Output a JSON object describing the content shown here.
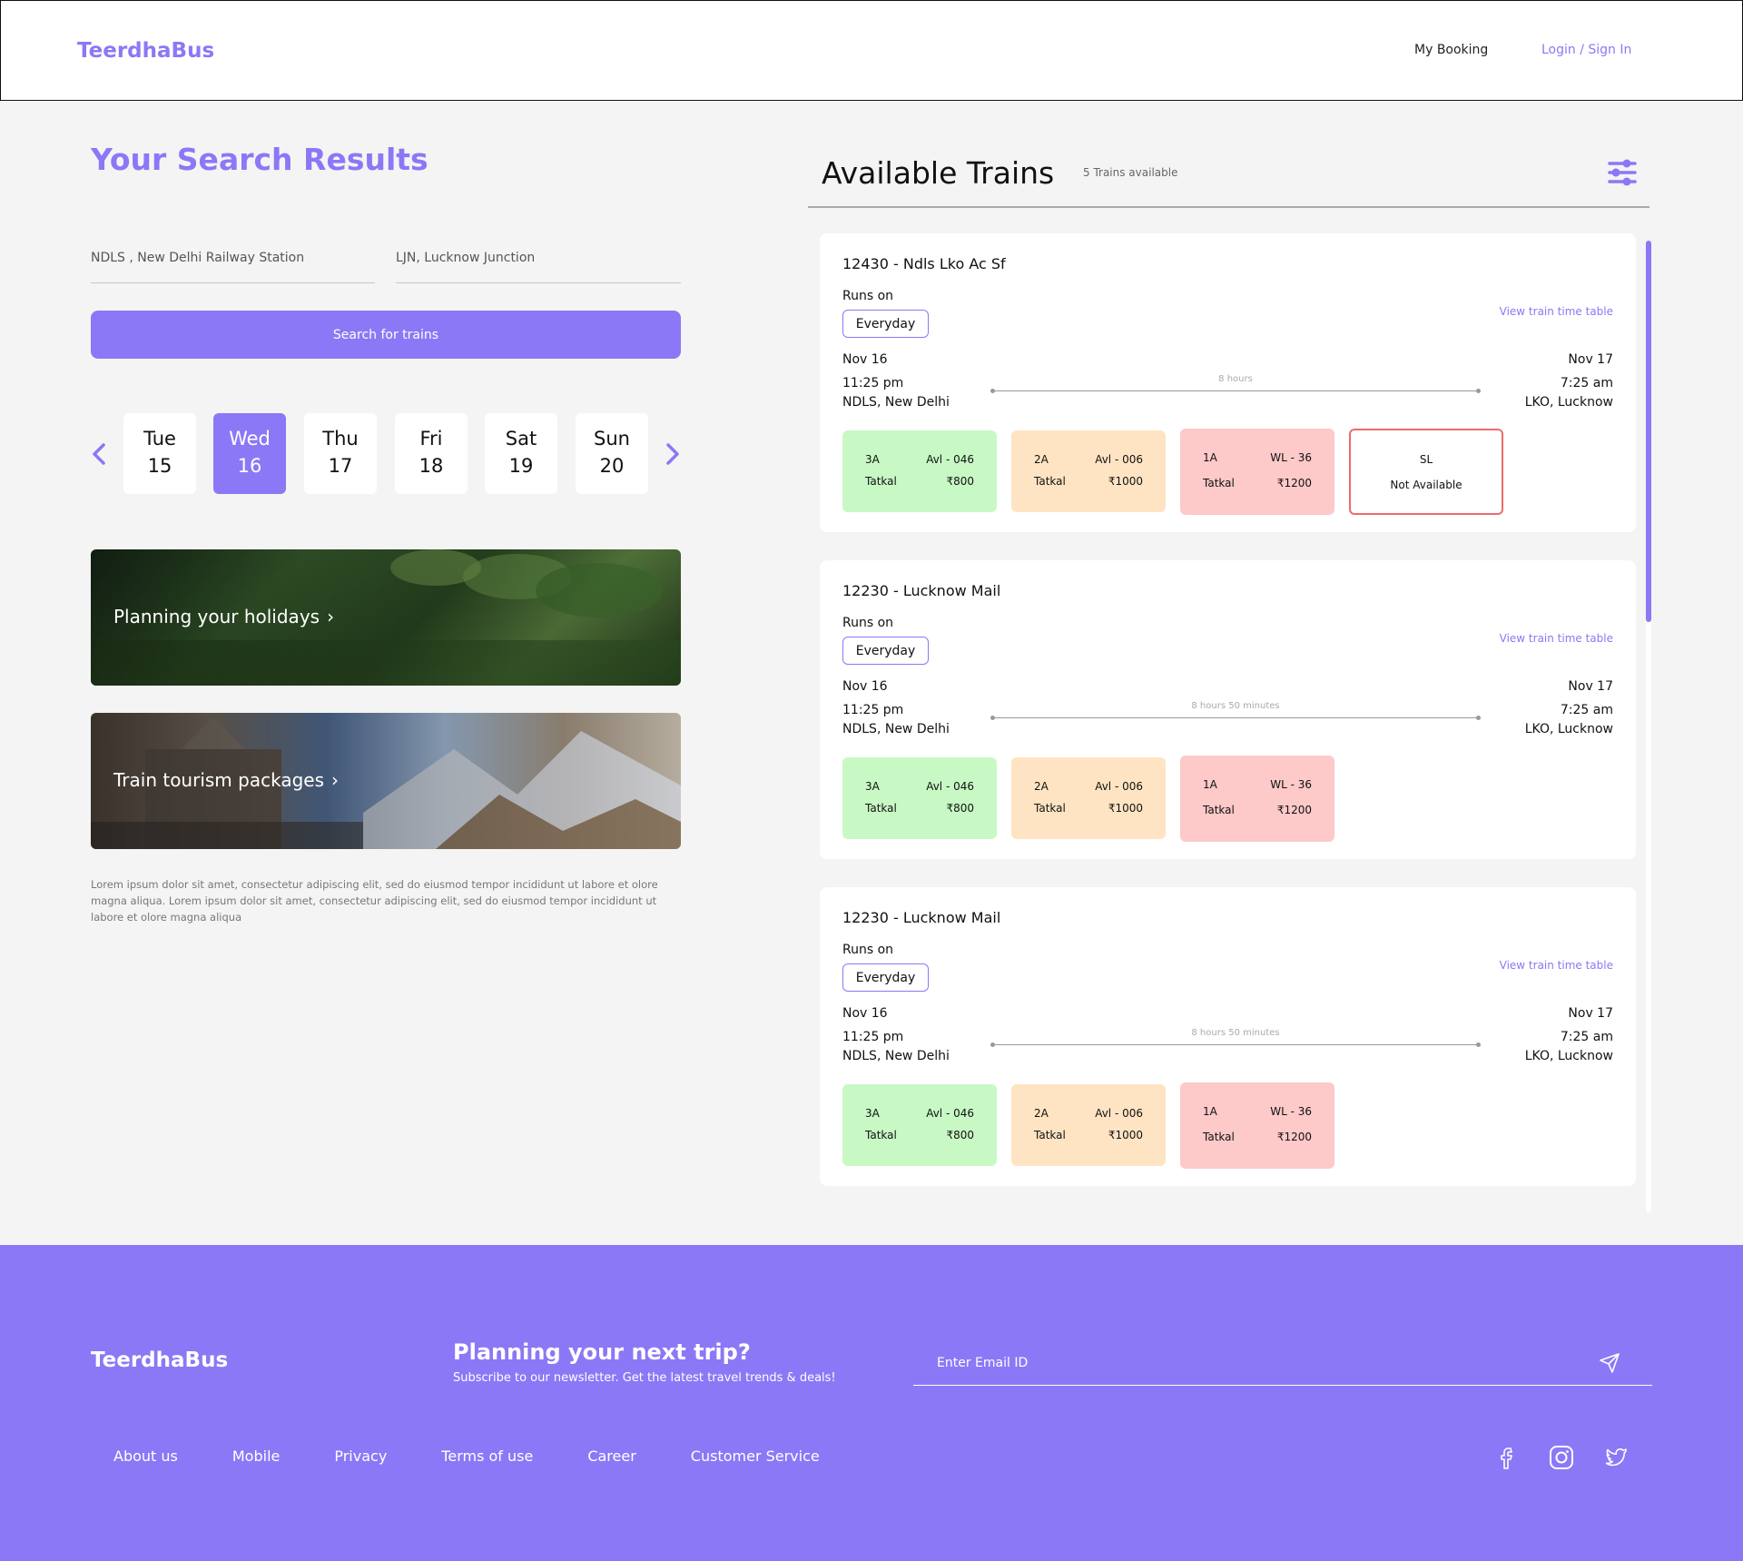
{
  "header": {
    "logo": "TeerdhaBus",
    "nav": {
      "booking": "My Booking",
      "login": "Login / Sign In"
    }
  },
  "search": {
    "title": "Your Search Results",
    "from": "NDLS , New Delhi Railway Station",
    "to": "LJN, Lucknow Junction",
    "button": "Search for trains"
  },
  "dates": [
    {
      "day": "Tue",
      "num": "15",
      "active": false
    },
    {
      "day": "Wed",
      "num": "16",
      "active": true
    },
    {
      "day": "Thu",
      "num": "17",
      "active": false
    },
    {
      "day": "Fri",
      "num": "18",
      "active": false
    },
    {
      "day": "Sat",
      "num": "19",
      "active": false
    },
    {
      "day": "Sun",
      "num": "20",
      "active": false
    }
  ],
  "promos": [
    {
      "text": "Planning your holidays"
    },
    {
      "text": "Train tourism packages"
    }
  ],
  "lorem": "Lorem ipsum dolor sit amet, consectetur adipiscing elit, sed do eiusmod tempor incididunt ut labore et olore magna aliqua. Lorem ipsum dolor sit amet, consectetur adipiscing elit, sed do eiusmod tempor incididunt ut labore et olore magna aliqua",
  "available": {
    "title": "Available Trains",
    "count": "5 Trains available"
  },
  "trains": [
    {
      "name": "12430 - Ndls Lko Ac Sf",
      "runs_label": "Runs on",
      "runs": "Everyday",
      "timetable": "View train time table",
      "dep_date": "Nov 16",
      "dep_time": "11:25 pm",
      "dep_station": "NDLS, New Delhi",
      "arr_date": "Nov 17",
      "arr_time": "7:25 am",
      "arr_station": "LKO, Lucknow",
      "duration": "8 hours",
      "fares": [
        {
          "cls": "3A",
          "avl": "Avl - 046",
          "quota": "Tatkal",
          "price": "₹800"
        },
        {
          "cls": "2A",
          "avl": "Avl - 006",
          "quota": "Tatkal",
          "price": "₹1000"
        },
        {
          "cls": "1A",
          "avl": "WL - 36",
          "quota": "Tatkal",
          "price": "₹1200"
        },
        {
          "cls": "SL",
          "status": "Not Available"
        }
      ]
    },
    {
      "name": "12230 - Lucknow Mail",
      "runs_label": "Runs on",
      "runs": "Everyday",
      "timetable": "View train time table",
      "dep_date": "Nov 16",
      "dep_time": "11:25 pm",
      "dep_station": "NDLS, New Delhi",
      "arr_date": "Nov 17",
      "arr_time": "7:25 am",
      "arr_station": "LKO, Lucknow",
      "duration": "8 hours 50 minutes",
      "fares": [
        {
          "cls": "3A",
          "avl": "Avl - 046",
          "quota": "Tatkal",
          "price": "₹800"
        },
        {
          "cls": "2A",
          "avl": "Avl - 006",
          "quota": "Tatkal",
          "price": "₹1000"
        },
        {
          "cls": "1A",
          "avl": "WL - 36",
          "quota": "Tatkal",
          "price": "₹1200"
        }
      ]
    },
    {
      "name": "12230 - Lucknow Mail",
      "runs_label": "Runs on",
      "runs": "Everyday",
      "timetable": "View train time table",
      "dep_date": "Nov 16",
      "dep_time": "11:25 pm",
      "dep_station": "NDLS, New Delhi",
      "arr_date": "Nov 17",
      "arr_time": "7:25 am",
      "arr_station": "LKO, Lucknow",
      "duration": "8 hours 50 minutes",
      "fares": [
        {
          "cls": "3A",
          "avl": "Avl - 046",
          "quota": "Tatkal",
          "price": "₹800"
        },
        {
          "cls": "2A",
          "avl": "Avl - 006",
          "quota": "Tatkal",
          "price": "₹1000"
        },
        {
          "cls": "1A",
          "avl": "WL - 36",
          "quota": "Tatkal",
          "price": "₹1200"
        }
      ]
    }
  ],
  "footer": {
    "logo": "TeerdhaBus",
    "title": "Planning your next trip?",
    "subtitle": "Subscribe to our newsletter. Get the latest travel trends & deals!",
    "email_placeholder": "Enter Email ID",
    "links": [
      "About us",
      "Mobile",
      "Privacy",
      "Terms of use",
      "Career",
      "Customer Service"
    ]
  },
  "icons": {
    "prev": "chevron-left-icon",
    "next": "chevron-right-icon",
    "filter": "sliders-icon",
    "send": "send-icon",
    "social": [
      "facebook-icon",
      "instagram-icon",
      "twitter-icon"
    ]
  },
  "colors": {
    "accent": "#8b78f6",
    "green": "#c8f9c4",
    "orange": "#ffe4c3",
    "red": "#fdc9c9"
  }
}
